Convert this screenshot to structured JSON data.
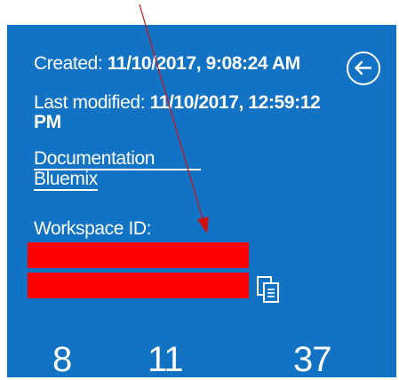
{
  "workspace": {
    "created_label": "Created:",
    "created_value": "11/10/2017, 9:08:24 AM",
    "modified_label": "Last modified:",
    "modified_value": "11/10/2017, 12:59:12 PM",
    "documentation_link": "Documentation",
    "bluemix_link": "Bluemix",
    "workspace_id_label": "Workspace ID:",
    "workspace_id_value": "[redacted]"
  },
  "stats": [
    "8",
    "11",
    "37"
  ],
  "icons": {
    "back": "back-arrow-circle-icon",
    "copy": "copy-icon"
  },
  "colors": {
    "panel": "#1273c5",
    "redaction": "#ff0000",
    "annotation_arrow": "#d01010",
    "text": "#ffffff"
  }
}
